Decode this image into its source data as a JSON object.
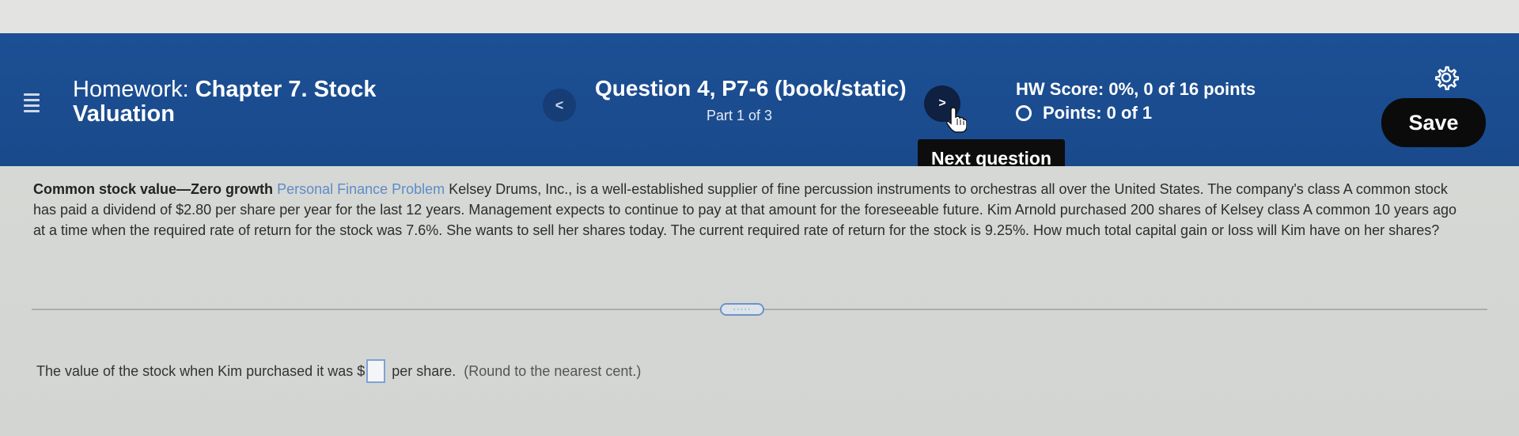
{
  "header": {
    "homework_prefix": "Homework: ",
    "homework_name": "Chapter 7. Stock Valuation",
    "question_title": "Question 4, P7-6 (book/static)",
    "question_part": "Part 1 of 3",
    "prev_label": "<",
    "next_label": ">",
    "next_tooltip": "Next question",
    "hw_score": "HW Score: 0%, 0 of 16 points",
    "points": "Points: 0 of 1",
    "save_label": "Save"
  },
  "problem": {
    "heading": "Common stock value—Zero growth",
    "tag": "Personal Finance Problem",
    "text": "Kelsey Drums, Inc., is a well-established supplier of fine percussion instruments to orchestras all over the United States. The company's class A common stock has paid a dividend of $2.80 per share per year for the last 12 years. Management expects to continue to pay at that amount for the foreseeable future. Kim Arnold purchased 200 shares of Kelsey class A common 10 years ago at a time when the required rate of return for the stock was 7.6%. She wants to sell her shares today. The current required rate of return for the stock is 9.25%. How much total capital gain or loss will Kim have on her shares?"
  },
  "expand_label": "·····",
  "answer": {
    "prefix": "The value of the stock when Kim purchased it was $",
    "value": "",
    "suffix": "per share.",
    "hint": "(Round to the nearest cent.)"
  },
  "colors": {
    "header_bg": "#1c4f94",
    "link": "#5d8cc8",
    "save_bg": "#0b0b0b"
  },
  "icons": [
    "menu-icon",
    "chevron-left-icon",
    "chevron-right-icon",
    "hand-cursor-icon",
    "gear-icon",
    "radio-ring-icon"
  ]
}
